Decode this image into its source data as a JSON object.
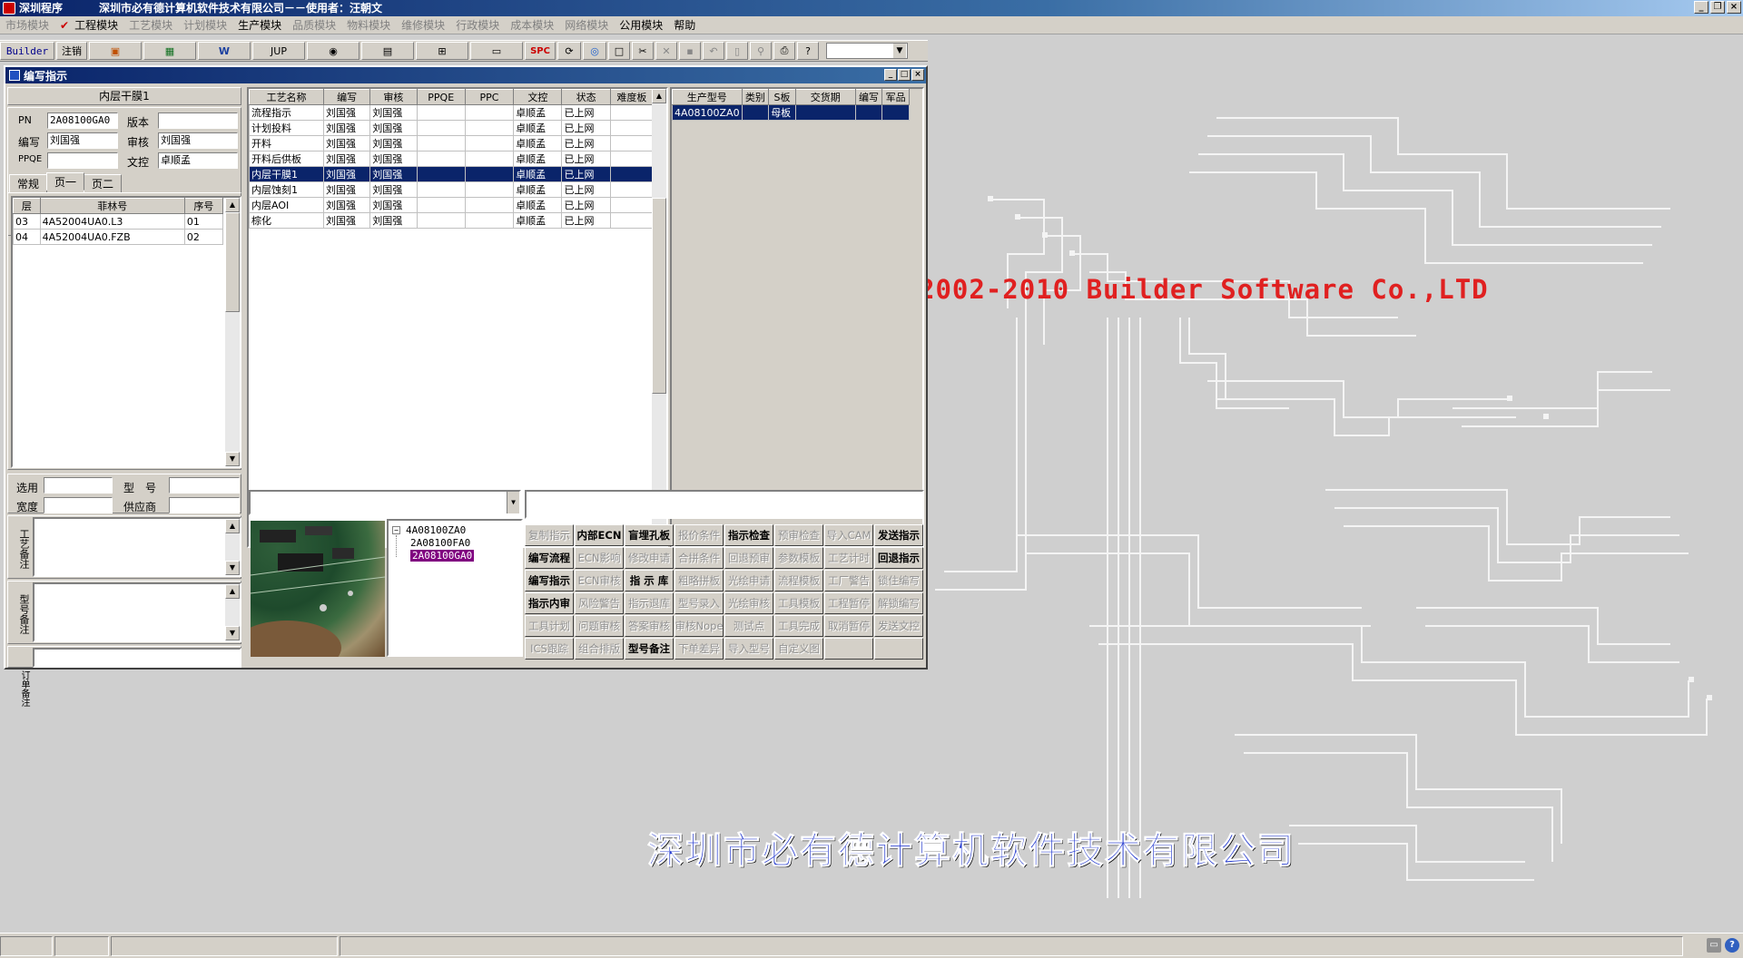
{
  "window": {
    "app_name": "深圳程序",
    "title": "深圳市必有德计算机软件技术有限公司－－使用者：汪朝文"
  },
  "menu": [
    {
      "label": "市场模块",
      "enabled": false
    },
    {
      "label": "工程模块",
      "enabled": true,
      "checked": true
    },
    {
      "label": "工艺模块",
      "enabled": false
    },
    {
      "label": "计划模块",
      "enabled": false
    },
    {
      "label": "生产模块",
      "enabled": true
    },
    {
      "label": "品质模块",
      "enabled": false
    },
    {
      "label": "物料模块",
      "enabled": false
    },
    {
      "label": "维修模块",
      "enabled": false
    },
    {
      "label": "行政模块",
      "enabled": false
    },
    {
      "label": "成本模块",
      "enabled": false
    },
    {
      "label": "网络模块",
      "enabled": false
    },
    {
      "label": "公用模块",
      "enabled": true
    },
    {
      "label": "帮助",
      "enabled": true
    }
  ],
  "toolbar": {
    "builder": "Builder",
    "logout": "注销",
    "jup": "JUP",
    "spc": "SPC"
  },
  "background": {
    "copyright": "2002-2010 Builder Software Co.,LTD",
    "company": "深圳市必有德计算机软件技术有限公司"
  },
  "dialog": {
    "title": "编写指示",
    "process_name": "内层干膜1",
    "fields": {
      "pn_label": "PN",
      "pn_value": "2A08100GA0",
      "version_label": "版本",
      "version_value": "",
      "writer_label": "编写",
      "writer_value": "刘国强",
      "reviewer_label": "审核",
      "reviewer_value": "刘国强",
      "ppqe_label": "PPQE",
      "ppqe_value": "",
      "doc_label": "文控",
      "doc_value": "卓顺孟"
    },
    "tabs": [
      "常规",
      "页一",
      "页二"
    ],
    "film_table": {
      "headers": [
        "层",
        "菲林号",
        "序号"
      ],
      "rows": [
        [
          "03",
          "4A52004UA0.L3",
          "01"
        ],
        [
          "04",
          "4A52004UA0.FZB",
          "02"
        ]
      ]
    },
    "material": {
      "select_label": "选用",
      "model_label": "型　号",
      "width_label": "宽度",
      "supplier_label": "供应商"
    },
    "remarks": [
      "工艺备注",
      "型号备注",
      "订单备注"
    ],
    "process_table": {
      "headers": [
        "工艺名称",
        "编写",
        "审核",
        "PPQE",
        "PPC",
        "文控",
        "状态",
        "难度板"
      ],
      "selected_index": 4,
      "rows": [
        [
          "流程指示",
          "刘国强",
          "刘国强",
          "",
          "",
          "卓顺孟",
          "已上网",
          ""
        ],
        [
          "计划投料",
          "刘国强",
          "刘国强",
          "",
          "",
          "卓顺孟",
          "已上网",
          ""
        ],
        [
          "开料",
          "刘国强",
          "刘国强",
          "",
          "",
          "卓顺孟",
          "已上网",
          ""
        ],
        [
          "开料后供板",
          "刘国强",
          "刘国强",
          "",
          "",
          "卓顺孟",
          "已上网",
          ""
        ],
        [
          "内层干膜1",
          "刘国强",
          "刘国强",
          "",
          "",
          "卓顺孟",
          "已上网",
          ""
        ],
        [
          "内层蚀刻1",
          "刘国强",
          "刘国强",
          "",
          "",
          "卓顺孟",
          "已上网",
          ""
        ],
        [
          "内层AOI",
          "刘国强",
          "刘国强",
          "",
          "",
          "卓顺孟",
          "已上网",
          ""
        ],
        [
          "棕化",
          "刘国强",
          "刘国强",
          "",
          "",
          "卓顺孟",
          "已上网",
          ""
        ]
      ]
    },
    "model_table": {
      "headers": [
        "生产型号",
        "类别",
        "S板",
        "交货期",
        "编写",
        "军品"
      ],
      "rows": [
        [
          "4A08100ZA0",
          "",
          "母板",
          "",
          "",
          ""
        ]
      ]
    },
    "tree": {
      "root": "4A08100ZA0",
      "children": [
        "2A08100FA0",
        "2A08100GA0"
      ],
      "selected": "2A08100GA0"
    },
    "buttons": [
      {
        "label": "复制指示",
        "enabled": false
      },
      {
        "label": "内部ECN",
        "enabled": true
      },
      {
        "label": "盲埋孔板",
        "enabled": true
      },
      {
        "label": "报价条件",
        "enabled": false
      },
      {
        "label": "指示检查",
        "enabled": true
      },
      {
        "label": "预审检查",
        "enabled": false
      },
      {
        "label": "导入CAM",
        "enabled": false
      },
      {
        "label": "发送指示",
        "enabled": true
      },
      {
        "label": "编写流程",
        "enabled": true
      },
      {
        "label": "ECN影响",
        "enabled": false
      },
      {
        "label": "修改申请",
        "enabled": false
      },
      {
        "label": "合拼条件",
        "enabled": false
      },
      {
        "label": "回退预审",
        "enabled": false
      },
      {
        "label": "参数模板",
        "enabled": false
      },
      {
        "label": "工艺计时",
        "enabled": false
      },
      {
        "label": "回退指示",
        "enabled": true
      },
      {
        "label": "编写指示",
        "enabled": true
      },
      {
        "label": "ECN审核",
        "enabled": false
      },
      {
        "label": "指 示 库",
        "enabled": true
      },
      {
        "label": "粗略拼板",
        "enabled": false
      },
      {
        "label": "光绘申请",
        "enabled": false
      },
      {
        "label": "流程模板",
        "enabled": false
      },
      {
        "label": "工厂警告",
        "enabled": false
      },
      {
        "label": "锁住编写",
        "enabled": false
      },
      {
        "label": "指示内审",
        "enabled": true
      },
      {
        "label": "风险警告",
        "enabled": false
      },
      {
        "label": "指示退库",
        "enabled": false
      },
      {
        "label": "型号录入",
        "enabled": false
      },
      {
        "label": "光绘审核",
        "enabled": false
      },
      {
        "label": "工具模板",
        "enabled": false
      },
      {
        "label": "工程暂停",
        "enabled": false
      },
      {
        "label": "解锁编写",
        "enabled": false
      },
      {
        "label": "工具计划",
        "enabled": false
      },
      {
        "label": "问题审核",
        "enabled": false
      },
      {
        "label": "答案审核",
        "enabled": false
      },
      {
        "label": "审核Nope",
        "enabled": false
      },
      {
        "label": "测试点",
        "enabled": false
      },
      {
        "label": "工具完成",
        "enabled": false
      },
      {
        "label": "取消暂停",
        "enabled": false
      },
      {
        "label": "发送文控",
        "enabled": false
      },
      {
        "label": "ICS跟踪",
        "enabled": false
      },
      {
        "label": "组合排版",
        "enabled": false
      },
      {
        "label": "型号备注",
        "enabled": true
      },
      {
        "label": "下单差异",
        "enabled": false
      },
      {
        "label": "导入型号",
        "enabled": false
      },
      {
        "label": "自定义图",
        "enabled": false
      },
      {
        "label": "",
        "enabled": false
      },
      {
        "label": "",
        "enabled": false
      }
    ]
  },
  "colors": {
    "title_bar": "#0a246a",
    "selection": "#0a246a",
    "copyright_text": "#e02020",
    "company_text": "#2a3fd0",
    "tree_selection": "#800080"
  }
}
